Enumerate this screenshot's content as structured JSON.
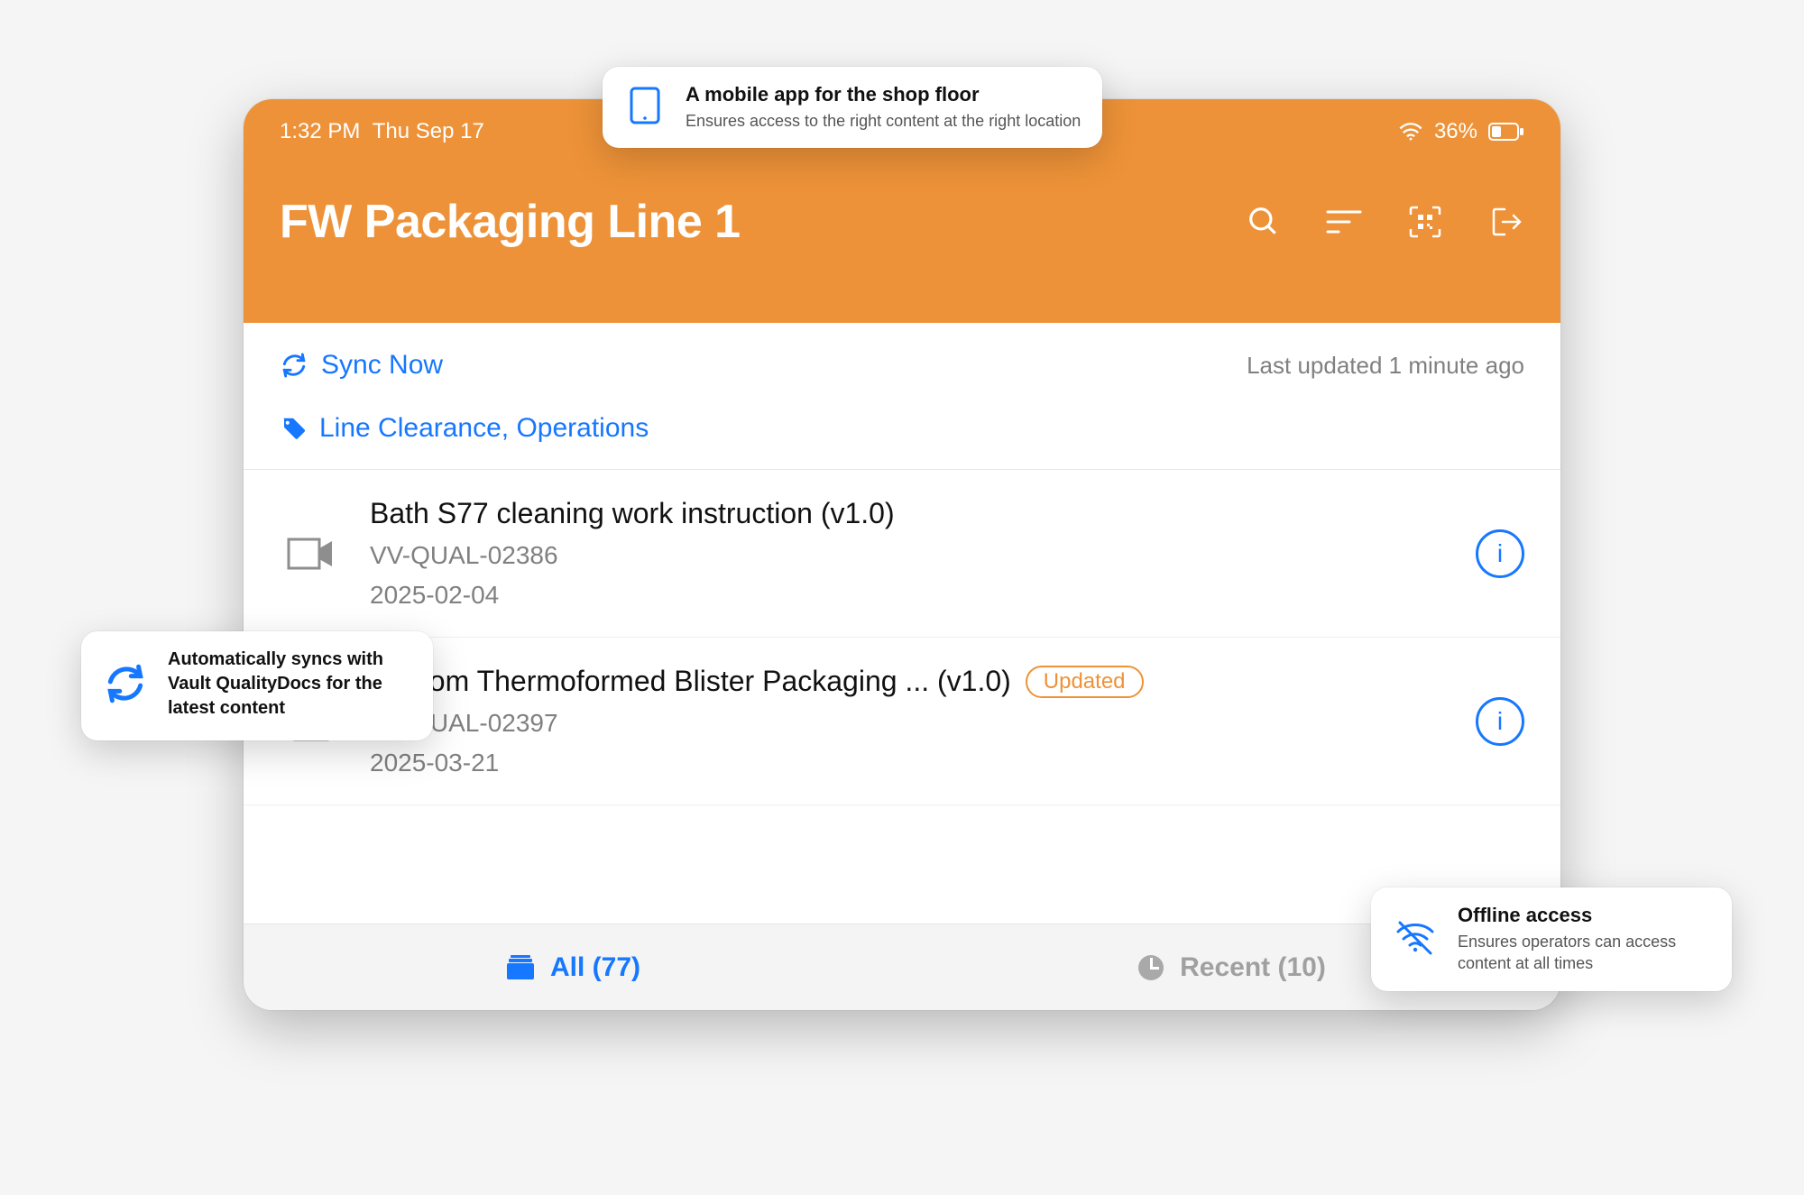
{
  "status": {
    "time": "1:32 PM",
    "date": "Thu Sep 17",
    "battery": "36%"
  },
  "header": {
    "title": "FW Packaging Line 1"
  },
  "sync": {
    "action_label": "Sync Now",
    "last_updated": "Last updated 1 minute ago"
  },
  "tags": {
    "text": "Line Clearance, Operations"
  },
  "docs": [
    {
      "title": "Bath S77 cleaning work instruction (v1.0)",
      "code": "VV-QUAL-02386",
      "date": "2025-02-04",
      "icon": "video",
      "updated": false
    },
    {
      "title": "Custom Thermoformed Blister Packaging ... (v1.0)",
      "code": "VV-QUAL-02397",
      "date": "2025-03-21",
      "icon": "doc",
      "updated": true,
      "updated_label": "Updated"
    }
  ],
  "tabs": {
    "all_label": "All (77)",
    "recent_label": "Recent (10)"
  },
  "callouts": {
    "top": {
      "title": "A mobile app for the shop floor",
      "sub": "Ensures access to the right content at the right location"
    },
    "left": {
      "title": "Automatically syncs with Vault QualityDocs for the latest content"
    },
    "right": {
      "title": "Offline access",
      "sub": "Ensures operators can access content at all times"
    }
  }
}
